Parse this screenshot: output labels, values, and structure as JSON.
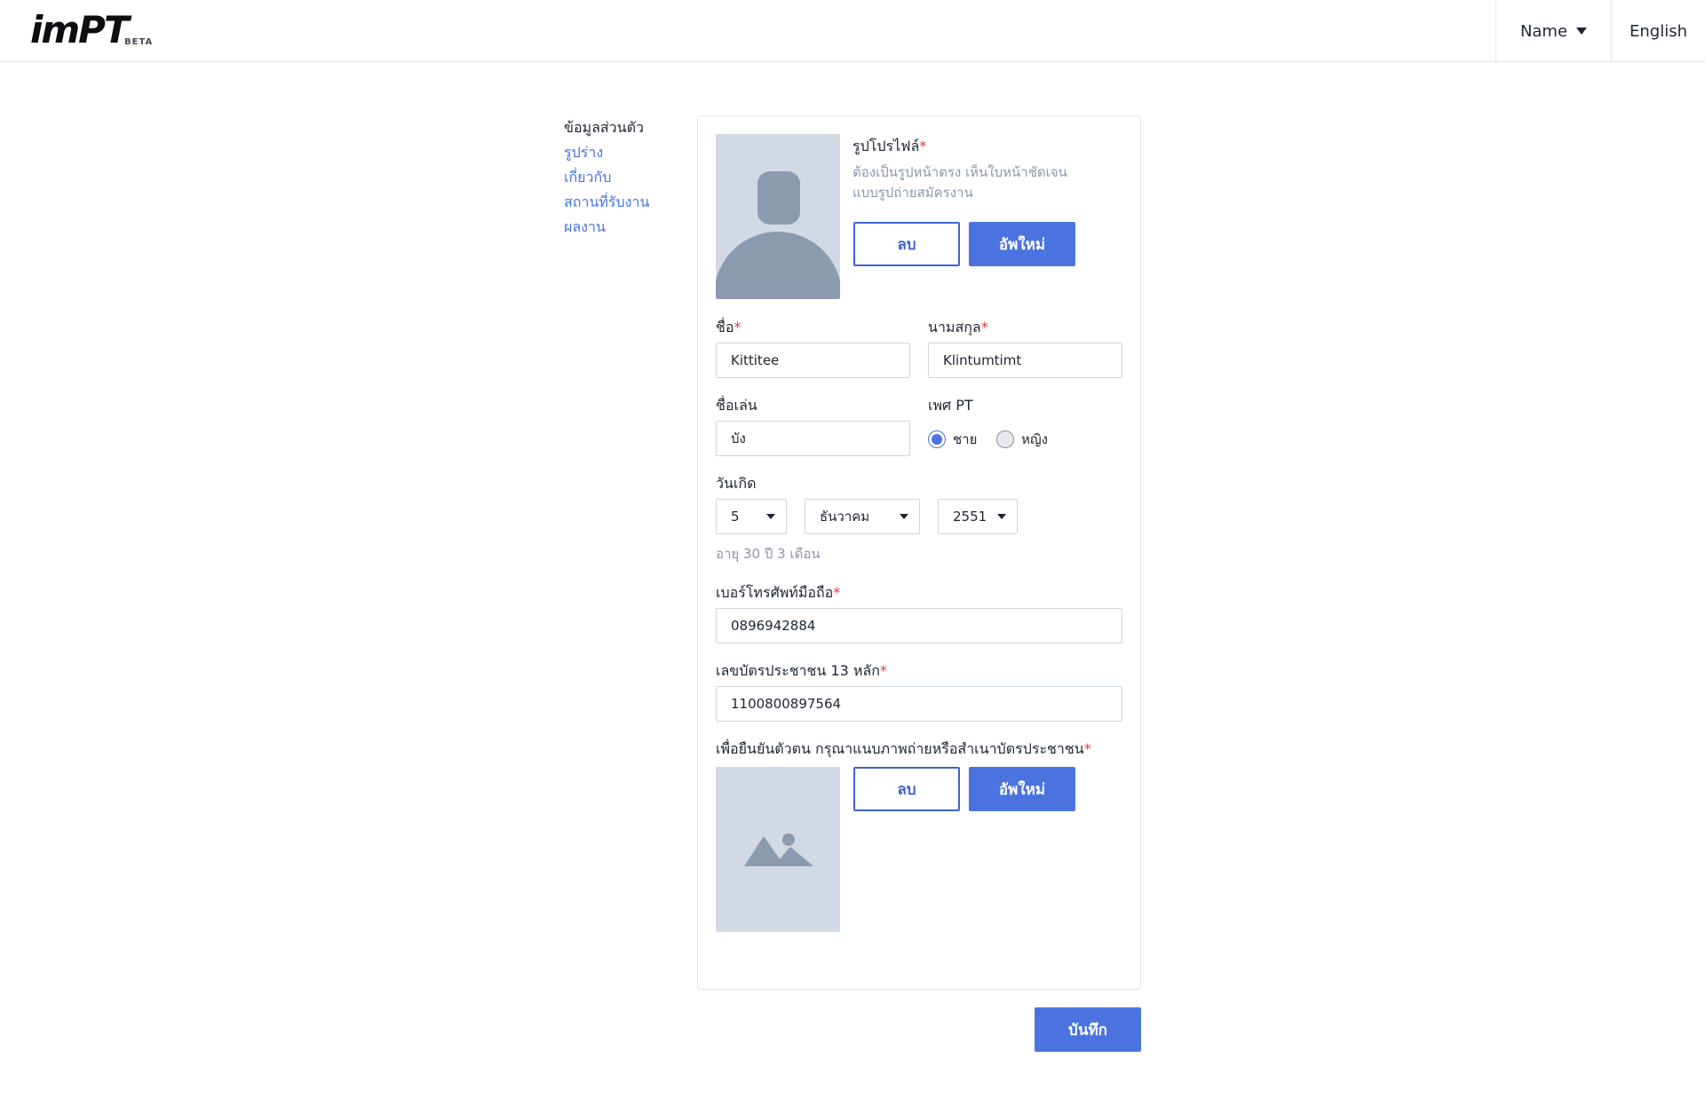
{
  "header": {
    "logo_text": "imPT",
    "logo_badge": "BETA",
    "user_menu_label": "Name",
    "language_label": "English"
  },
  "sidenav": {
    "items": [
      {
        "label": "ข้อมูลส่วนตัว",
        "active": true
      },
      {
        "label": "รูปร่าง",
        "active": false
      },
      {
        "label": "เกี่ยวกับ",
        "active": false
      },
      {
        "label": "สถานที่รับงาน",
        "active": false
      },
      {
        "label": "ผลงาน",
        "active": false
      }
    ]
  },
  "form": {
    "profile_photo": {
      "label": "รูปโปรไฟล์",
      "required_mark": "*",
      "hint_line1": "ต้องเป็นรูปหน้าตรง เห็นใบหน้าชัดเจน",
      "hint_line2": "แบบรูปถ่ายสมัครงาน",
      "delete_label": "ลบ",
      "upload_label": "อัพใหม่"
    },
    "first_name": {
      "label": "ชื่อ",
      "required_mark": "*",
      "value": "Kittitee"
    },
    "last_name": {
      "label": "นามสกุล",
      "required_mark": "*",
      "value": "Klintumtimt"
    },
    "nickname": {
      "label": "ชื่อเล่น",
      "value": "บัง"
    },
    "gender": {
      "label": "เพศ PT",
      "options": [
        {
          "label": "ชาย",
          "checked": true
        },
        {
          "label": "หญิง",
          "checked": false
        }
      ]
    },
    "birthdate": {
      "label": "วันเกิด",
      "day": "5",
      "month": "ธันวาคม",
      "year": "2551",
      "age_text": "อายุ 30 ปี 3 เดือน"
    },
    "phone": {
      "label": "เบอร์โทรศัพท์มือถือ",
      "required_mark": "*",
      "value": "0896942884"
    },
    "national_id": {
      "label": "เลขบัตรประชาชน 13 หลัก",
      "required_mark": "*",
      "value": "1100800897564"
    },
    "id_photo": {
      "label": "เพื่อยืนยันตัวตน กรุณาแนบภาพถ่ายหรือสำเนาบัตรประชาชน",
      "required_mark": "*",
      "delete_label": "ลบ",
      "upload_label": "อัพใหม่"
    },
    "save_label": "บันทึก"
  },
  "colors": {
    "accent": "#4a73e0",
    "link": "#4a74dc",
    "required": "#e0373b",
    "placeholder_bg": "#d2d9e4",
    "placeholder_fg": "#8c9ab0"
  },
  "icons": [
    "caret-down-icon",
    "person-placeholder-icon",
    "image-placeholder-icon",
    "radio-icon"
  ]
}
